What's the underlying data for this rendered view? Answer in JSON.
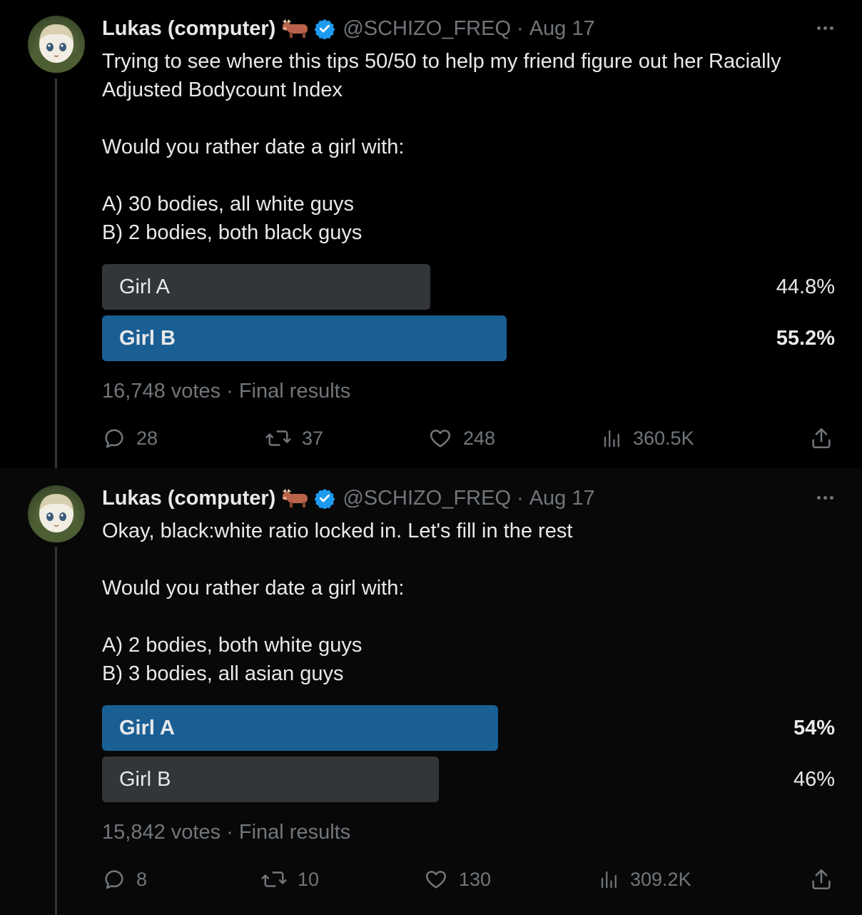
{
  "colors": {
    "background": "#000000",
    "text_primary": "#e7e9ea",
    "text_secondary": "#71767b",
    "poll_winner": "#1a5f94",
    "poll_other": "#333639",
    "verified": "#1d9bf0"
  },
  "tweets": [
    {
      "author": {
        "display_name": "Lukas (computer)",
        "emoji": "ox-emoji",
        "verified": true,
        "handle": "@SCHIZO_FREQ"
      },
      "date": "Aug 17",
      "dot": "·",
      "text_lines": [
        "Trying to see where this tips 50/50 to help my friend figure out her Racially",
        "Adjusted Bodycount Index",
        "",
        "Would you rather date a girl with:",
        "",
        "A) 30 bodies, all white guys",
        "B) 2 bodies, both black guys"
      ],
      "poll": {
        "options": [
          {
            "label": "Girl A",
            "percent_text": "44.8%",
            "percent": 44.8,
            "winner": false
          },
          {
            "label": "Girl B",
            "percent_text": "55.2%",
            "percent": 55.2,
            "winner": true
          }
        ],
        "votes": "16,748 votes",
        "status": "Final results"
      },
      "metrics": {
        "replies": "28",
        "reposts": "37",
        "likes": "248",
        "views": "360.5K"
      }
    },
    {
      "author": {
        "display_name": "Lukas (computer)",
        "emoji": "ox-emoji",
        "verified": true,
        "handle": "@SCHIZO_FREQ"
      },
      "date": "Aug 17",
      "dot": "·",
      "text_lines": [
        "Okay, black:white ratio locked in. Let's fill in the rest",
        "",
        "Would you rather date a girl with:",
        "",
        "A) 2 bodies, both white guys",
        "B) 3 bodies, all asian guys"
      ],
      "poll": {
        "options": [
          {
            "label": "Girl A",
            "percent_text": "54%",
            "percent": 54,
            "winner": true
          },
          {
            "label": "Girl B",
            "percent_text": "46%",
            "percent": 46,
            "winner": false
          }
        ],
        "votes": "15,842 votes",
        "status": "Final results"
      },
      "metrics": {
        "replies": "8",
        "reposts": "10",
        "likes": "130",
        "views": "309.2K"
      }
    }
  ]
}
